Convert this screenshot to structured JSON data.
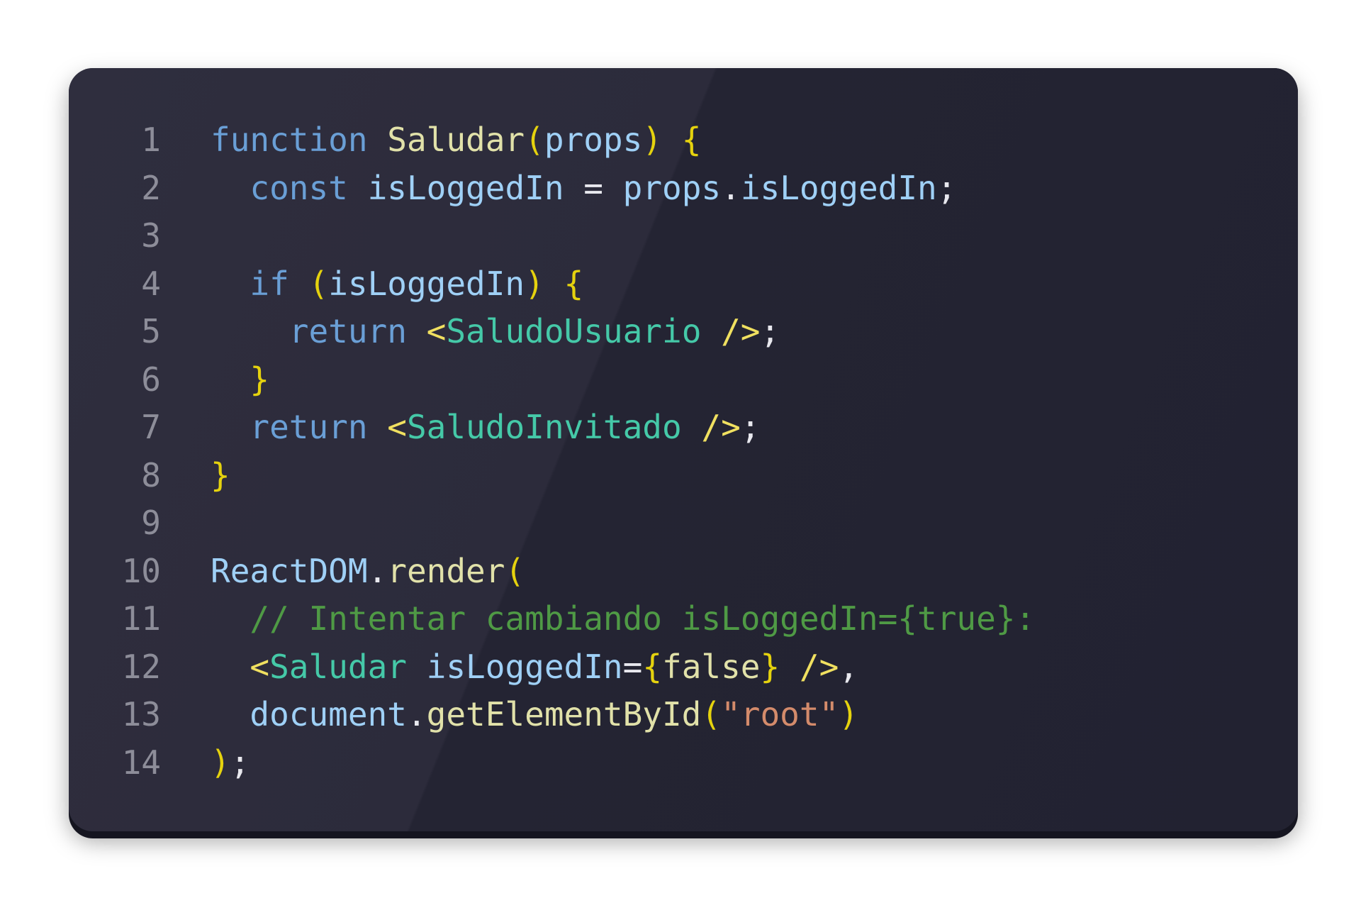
{
  "code": {
    "line_numbers": [
      "1",
      "2",
      "3",
      "4",
      "5",
      "6",
      "7",
      "8",
      "9",
      "10",
      "11",
      "12",
      "13",
      "14"
    ],
    "lines": [
      [
        {
          "t": "function",
          "c": "kw"
        },
        {
          "t": " ",
          "c": "pl"
        },
        {
          "t": "Saludar",
          "c": "fn"
        },
        {
          "t": "(",
          "c": "br"
        },
        {
          "t": "props",
          "c": "var"
        },
        {
          "t": ")",
          "c": "br"
        },
        {
          "t": " ",
          "c": "pl"
        },
        {
          "t": "{",
          "c": "br"
        }
      ],
      [
        {
          "t": "  ",
          "c": "pl"
        },
        {
          "t": "const",
          "c": "kw"
        },
        {
          "t": " ",
          "c": "pl"
        },
        {
          "t": "isLoggedIn",
          "c": "var"
        },
        {
          "t": " = ",
          "c": "pl"
        },
        {
          "t": "props",
          "c": "var"
        },
        {
          "t": ".",
          "c": "pl"
        },
        {
          "t": "isLoggedIn",
          "c": "var"
        },
        {
          "t": ";",
          "c": "pl"
        }
      ],
      [],
      [
        {
          "t": "  ",
          "c": "pl"
        },
        {
          "t": "if",
          "c": "kw"
        },
        {
          "t": " ",
          "c": "pl"
        },
        {
          "t": "(",
          "c": "br"
        },
        {
          "t": "isLoggedIn",
          "c": "var"
        },
        {
          "t": ")",
          "c": "br"
        },
        {
          "t": " ",
          "c": "pl"
        },
        {
          "t": "{",
          "c": "br"
        }
      ],
      [
        {
          "t": "    ",
          "c": "pl"
        },
        {
          "t": "return",
          "c": "kw"
        },
        {
          "t": " ",
          "c": "pl"
        },
        {
          "t": "<",
          "c": "jsx"
        },
        {
          "t": "SaludoUsuario",
          "c": "tag"
        },
        {
          "t": " ",
          "c": "pl"
        },
        {
          "t": "/>",
          "c": "jsx"
        },
        {
          "t": ";",
          "c": "pl"
        }
      ],
      [
        {
          "t": "  ",
          "c": "pl"
        },
        {
          "t": "}",
          "c": "br"
        }
      ],
      [
        {
          "t": "  ",
          "c": "pl"
        },
        {
          "t": "return",
          "c": "kw"
        },
        {
          "t": " ",
          "c": "pl"
        },
        {
          "t": "<",
          "c": "jsx"
        },
        {
          "t": "SaludoInvitado",
          "c": "tag"
        },
        {
          "t": " ",
          "c": "pl"
        },
        {
          "t": "/>",
          "c": "jsx"
        },
        {
          "t": ";",
          "c": "pl"
        }
      ],
      [
        {
          "t": "}",
          "c": "br"
        }
      ],
      [],
      [
        {
          "t": "ReactDOM",
          "c": "var"
        },
        {
          "t": ".",
          "c": "pl"
        },
        {
          "t": "render",
          "c": "fn"
        },
        {
          "t": "(",
          "c": "br"
        }
      ],
      [
        {
          "t": "  ",
          "c": "pl"
        },
        {
          "t": "// Intentar cambiando isLoggedIn={true}:",
          "c": "cm"
        }
      ],
      [
        {
          "t": "  ",
          "c": "pl"
        },
        {
          "t": "<",
          "c": "jsx"
        },
        {
          "t": "Saludar",
          "c": "tag"
        },
        {
          "t": " ",
          "c": "pl"
        },
        {
          "t": "isLoggedIn",
          "c": "var"
        },
        {
          "t": "=",
          "c": "pl"
        },
        {
          "t": "{",
          "c": "br"
        },
        {
          "t": "false",
          "c": "fn"
        },
        {
          "t": "}",
          "c": "br"
        },
        {
          "t": " ",
          "c": "pl"
        },
        {
          "t": "/>",
          "c": "jsx"
        },
        {
          "t": ",",
          "c": "pl"
        }
      ],
      [
        {
          "t": "  ",
          "c": "pl"
        },
        {
          "t": "document",
          "c": "var"
        },
        {
          "t": ".",
          "c": "pl"
        },
        {
          "t": "getElementById",
          "c": "fn"
        },
        {
          "t": "(",
          "c": "br"
        },
        {
          "t": "\"root\"",
          "c": "str"
        },
        {
          "t": ")",
          "c": "br"
        }
      ],
      [
        {
          "t": ")",
          "c": "br"
        },
        {
          "t": ";",
          "c": "pl"
        }
      ]
    ]
  },
  "colors": {
    "card_background": "#232332",
    "page_background": "#ffffff",
    "keyword": "#6a9fd6",
    "function": "#e1e1a9",
    "variable": "#9fd0f6",
    "bracket": "#e5d20e",
    "jsx_tag": "#45c9a8",
    "comment": "#4f9a45",
    "string": "#d48b6b",
    "line_number": "#8d8d99"
  }
}
